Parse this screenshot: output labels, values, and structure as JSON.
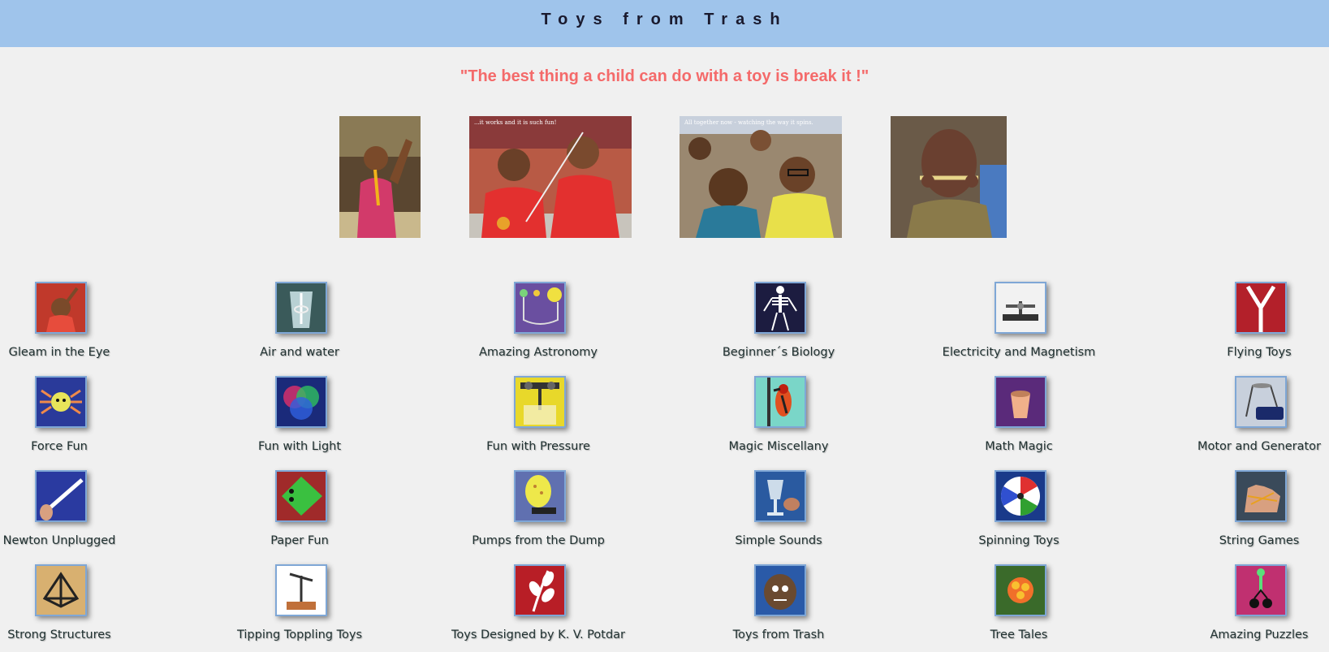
{
  "header": {
    "title": "Toys from Trash"
  },
  "quote": "\"The best thing a child can do with a toy is break it !\"",
  "photos": [
    {
      "caption": ""
    },
    {
      "caption": "...it works and it is such fun!"
    },
    {
      "caption": "All together now - watching the way it spins."
    },
    {
      "caption": ""
    }
  ],
  "categories": [
    {
      "label": "Gleam in the Eye",
      "icon": "child-smiling-icon"
    },
    {
      "label": "Air and water",
      "icon": "water-glass-icon"
    },
    {
      "label": "Amazing Astronomy",
      "icon": "planets-model-icon"
    },
    {
      "label": "Beginner´s Biology",
      "icon": "skeleton-icon"
    },
    {
      "label": "Electricity and Magnetism",
      "icon": "motor-model-icon"
    },
    {
      "label": "Flying Toys",
      "icon": "flying-toy-icon"
    },
    {
      "label": "Force Fun",
      "icon": "spider-toy-icon"
    },
    {
      "label": "Fun with Light",
      "icon": "color-circles-icon"
    },
    {
      "label": "Fun with Pressure",
      "icon": "pressure-bottle-icon"
    },
    {
      "label": "Magic Miscellany",
      "icon": "woodpecker-toy-icon"
    },
    {
      "label": "Math Magic",
      "icon": "paper-cup-icon"
    },
    {
      "label": "Motor and Generator",
      "icon": "battery-motor-icon"
    },
    {
      "label": "Newton Unplugged",
      "icon": "straw-rocket-icon"
    },
    {
      "label": "Paper Fun",
      "icon": "paper-frog-icon"
    },
    {
      "label": "Pumps from the Dump",
      "icon": "balloon-pump-icon"
    },
    {
      "label": "Simple Sounds",
      "icon": "glass-sound-icon"
    },
    {
      "label": "Spinning Toys",
      "icon": "color-wheel-icon"
    },
    {
      "label": "String Games",
      "icon": "string-hand-icon"
    },
    {
      "label": "Strong Structures",
      "icon": "stick-structure-icon"
    },
    {
      "label": "Tipping Toppling Toys",
      "icon": "balancing-toy-icon"
    },
    {
      "label": "Toys Designed by K. V. Potdar",
      "icon": "leaf-design-icon"
    },
    {
      "label": "Toys from Trash",
      "icon": "coconut-toy-icon"
    },
    {
      "label": "Tree Tales",
      "icon": "flower-cluster-icon"
    },
    {
      "label": "Amazing Puzzles",
      "icon": "key-puzzle-icon"
    }
  ]
}
